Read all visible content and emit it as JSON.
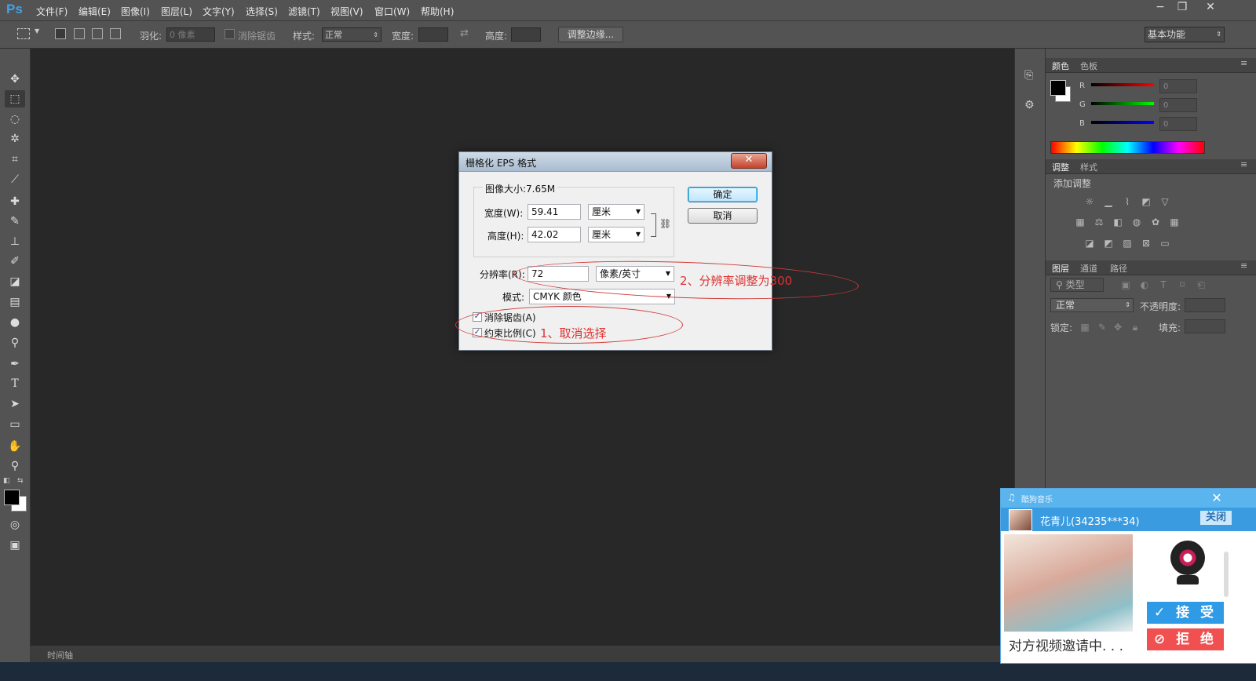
{
  "app": {
    "logo": "Ps",
    "menu": [
      "文件(F)",
      "编辑(E)",
      "图像(I)",
      "图层(L)",
      "文字(Y)",
      "选择(S)",
      "滤镜(T)",
      "视图(V)",
      "窗口(W)",
      "帮助(H)"
    ],
    "window_controls": {
      "minimize": "−",
      "restore": "❐",
      "close": "✕"
    }
  },
  "options_bar": {
    "feather_label": "羽化:",
    "feather_placeholder": "0 像素",
    "antialias_label": "消除锯齿",
    "style_label": "样式:",
    "style_value": "正常",
    "width_label": "宽度:",
    "height_label": "高度:",
    "refine_edge": "调整边缘...",
    "workspace": "基本功能"
  },
  "panels": {
    "color": {
      "tabs": [
        "颜色",
        "色板"
      ],
      "channels": [
        {
          "label": "R",
          "value": "0"
        },
        {
          "label": "G",
          "value": "0"
        },
        {
          "label": "B",
          "value": "0"
        }
      ]
    },
    "adjustments": {
      "tabs": [
        "调整",
        "样式"
      ],
      "title": "添加调整"
    },
    "layers": {
      "tabs": [
        "图层",
        "通道",
        "路径"
      ],
      "filter_label": "类型",
      "blend_mode": "正常",
      "opacity_label": "不透明度:",
      "lock_label": "锁定:",
      "fill_label": "填充:"
    }
  },
  "timeline_label": "时间轴",
  "dialog": {
    "title": "栅格化 EPS 格式",
    "close": "✕",
    "image_size": "图像大小:7.65M",
    "width_label": "宽度(W):",
    "width_value": "59.41",
    "width_unit": "厘米",
    "height_label": "高度(H):",
    "height_value": "42.02",
    "height_unit": "厘米",
    "resolution_label": "分辨率(R):",
    "resolution_value": "72",
    "resolution_unit": "像素/英寸",
    "mode_label": "模式:",
    "mode_value": "CMYK 颜色",
    "antialias_label": "消除锯齿(A)",
    "constrain_label": "约束比例(C)",
    "ok": "确定",
    "cancel": "取消"
  },
  "annotations": {
    "note1": "1、取消选择",
    "note2": "2、分辨率调整为300"
  },
  "popup": {
    "app_name": "酷狗音乐",
    "close_x": "✕",
    "user": "花青儿(34235***34)",
    "close_label": "关闭",
    "accept": "接 受",
    "reject": "拒 绝",
    "invite_text": "对方视频邀请中. . ."
  },
  "colors": {
    "accent": "#3fa3ec",
    "annotation": "#e03030",
    "ui_gray": "#535353",
    "canvas": "#282828",
    "accept": "#2f9be6",
    "reject": "#f05050"
  }
}
